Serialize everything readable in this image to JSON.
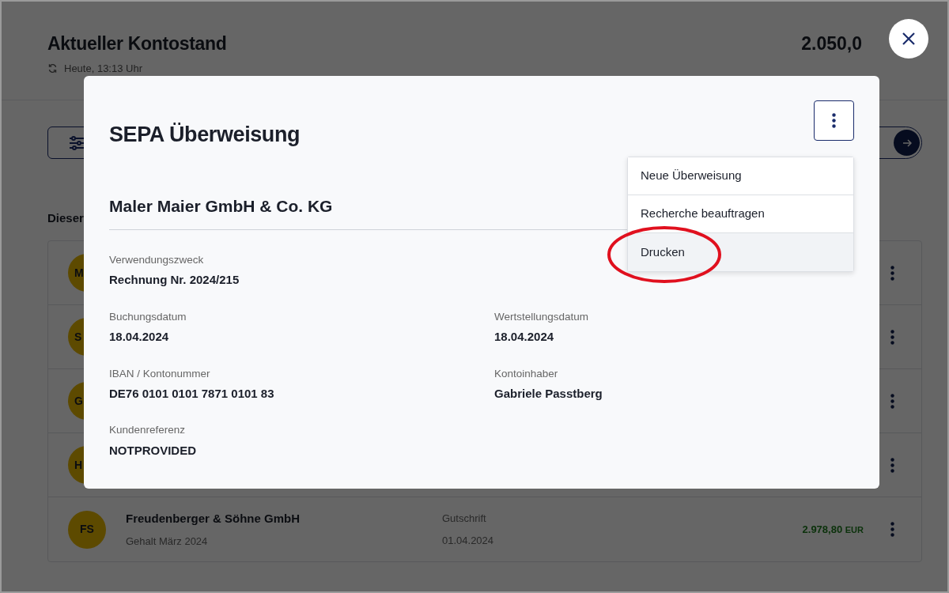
{
  "page": {
    "title": "Aktueller Kontostand",
    "updated": "Heute, 13:13 Uhr",
    "balance": "2.050,0",
    "section_label": "Dieser",
    "rows": [
      {
        "initials": "M"
      },
      {
        "initials": "S"
      },
      {
        "initials": "G"
      },
      {
        "initials": "H"
      },
      {
        "initials": "FS",
        "name": "Freudenberger & Söhne GmbH",
        "purpose": "Gehalt März 2024",
        "type": "Gutschrift",
        "date": "01.04.2024",
        "amount": "2.978,80",
        "currency": "EUR"
      }
    ]
  },
  "dialog": {
    "title": "SEPA Überweisung",
    "recipient": "Maler Maier GmbH & Co. KG",
    "menu": [
      {
        "label": "Neue Überweisung",
        "highlighted": false,
        "circled": false
      },
      {
        "label": "Recherche beauftragen",
        "highlighted": false,
        "circled": false
      },
      {
        "label": "Drucken",
        "highlighted": true,
        "circled": true
      }
    ],
    "field_rows": [
      [
        {
          "label": "Verwendungszweck",
          "value": "Rechnung Nr. 2024/215"
        }
      ],
      [
        {
          "label": "Buchungsdatum",
          "value": "18.04.2024"
        },
        {
          "label": "Wertstellungsdatum",
          "value": "18.04.2024"
        }
      ],
      [
        {
          "label": "IBAN / Kontonummer",
          "value": "DE76 0101 0101 7871 0101 83"
        },
        {
          "label": "Kontoinhaber",
          "value": "Gabriele Passtberg"
        }
      ],
      [
        {
          "label": "Kundenreferenz",
          "value": "NOTPROVIDED"
        }
      ]
    ]
  }
}
